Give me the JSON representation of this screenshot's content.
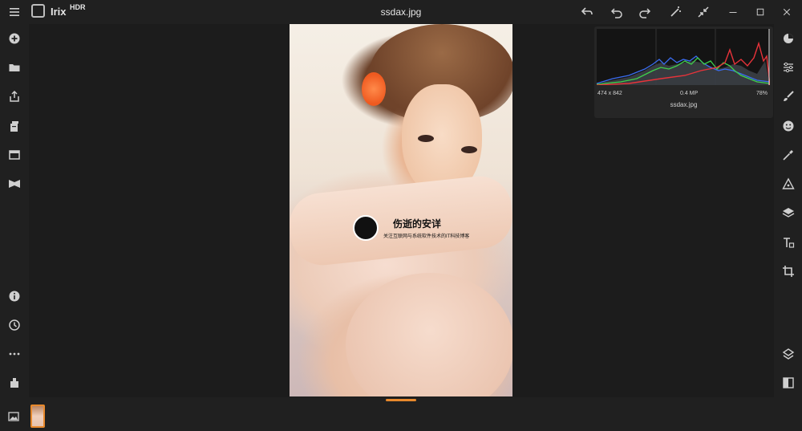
{
  "titlebar": {
    "app_name": "Irix",
    "app_suffix": "HDR",
    "document_title": "ssdax.jpg",
    "icons": [
      "menu-icon",
      "undo-all-icon",
      "undo-icon",
      "redo-icon",
      "magic-wand-icon",
      "collapse-icon",
      "minimize-icon",
      "maximize-icon",
      "close-icon"
    ]
  },
  "left_rail": {
    "icons": [
      "add-icon",
      "folder-icon",
      "export-icon",
      "batch-icon",
      "window-icon",
      "compare-icon",
      "info-icon",
      "history-icon",
      "more-icon",
      "plugin-icon"
    ]
  },
  "right_rail": {
    "icons": [
      "presets-icon",
      "adjustments-icon",
      "brush-icon",
      "face-icon",
      "eyedropper-icon",
      "triangle-icon",
      "layers-icon",
      "text-icon",
      "crop-icon",
      "stack-icon",
      "split-view-icon"
    ]
  },
  "watermark": {
    "title": "伤逝的安详",
    "subtitle": "关注互联网与系统软件技术的IT科技博客"
  },
  "histogram": {
    "dimensions": "474 x 842",
    "megapixels": "0.4 MP",
    "zoom": "78%",
    "filename": "ssdax.jpg",
    "colors": {
      "red": "#e8333a",
      "green": "#3fd14b",
      "blue": "#3a6cf0",
      "luma": "#9aa3ad"
    }
  },
  "filmstrip": {
    "active_thumb": "ssdax.jpg",
    "accent": "#e8892c"
  }
}
